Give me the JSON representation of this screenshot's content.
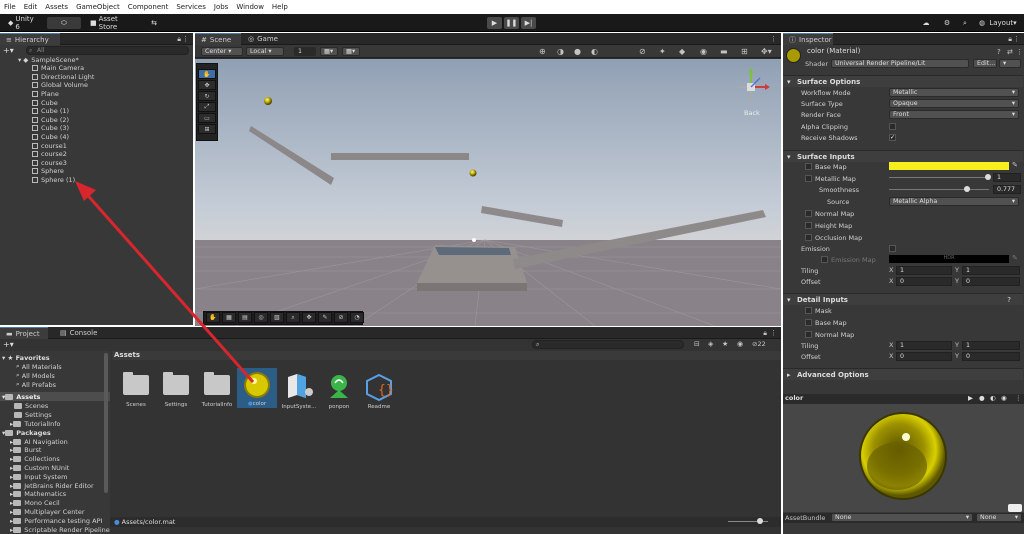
{
  "menubar": [
    "File",
    "Edit",
    "Assets",
    "GameObject",
    "Component",
    "Services",
    "Jobs",
    "Window",
    "Help"
  ],
  "toolbar": {
    "account": "Unity 6",
    "asset_store": "Asset Store",
    "layout": "Layout"
  },
  "hierarchy": {
    "tab": "Hierarchy",
    "search_placeholder": "All",
    "scene": "SampleScene*",
    "items": [
      "Main Camera",
      "Directional Light",
      "Global Volume",
      "Plane",
      "Cube",
      "Cube (1)",
      "Cube (2)",
      "Cube (3)",
      "Cube (4)",
      "course1",
      "course2",
      "course3",
      "Sphere",
      "Sphere (1)"
    ]
  },
  "scene_view": {
    "tabs": [
      "Scene",
      "Game"
    ],
    "pivot": "Center",
    "space": "Local",
    "snap": "1",
    "gizmo_label": "Back"
  },
  "project": {
    "tabs": [
      "Project",
      "Console"
    ],
    "favorites_label": "Favorites",
    "favorites": [
      "All Materials",
      "All Models",
      "All Prefabs"
    ],
    "assets_label": "Assets",
    "asset_folders": [
      "Scenes",
      "Settings",
      "TutorialInfo"
    ],
    "packages_label": "Packages",
    "packages": [
      "AI Navigation",
      "Burst",
      "Collections",
      "Custom NUnit",
      "Input System",
      "JetBrains Rider Editor",
      "Mathematics",
      "Mono Cecil",
      "Multiplayer Center",
      "Performance testing API",
      "Scriptable Render Pipeline"
    ],
    "breadcrumb": "Assets",
    "items": [
      "Scenes",
      "Settings",
      "TutorialInfo",
      "color",
      "InputSyste...",
      "ponpon",
      "Readme"
    ],
    "status_path": "Assets/color.mat",
    "count": "22"
  },
  "inspector": {
    "tab": "Inspector",
    "title": "color (Material)",
    "shader_label": "Shader",
    "shader_value": "Universal Render Pipeline/Lit",
    "edit_label": "Edit...",
    "surface_options": "Surface Options",
    "workflow_mode": {
      "label": "Workflow Mode",
      "value": "Metallic"
    },
    "surface_type": {
      "label": "Surface Type",
      "value": "Opaque"
    },
    "render_face": {
      "label": "Render Face",
      "value": "Front"
    },
    "alpha_clipping": "Alpha Clipping",
    "receive_shadows": "Receive Shadows",
    "surface_inputs": "Surface Inputs",
    "base_map": "Base Map",
    "base_color": "#f7ee1e",
    "metallic_map": "Metallic Map",
    "metallic_value": "1",
    "smoothness": "Smoothness",
    "smoothness_value": "0.777",
    "source": "Source",
    "source_value": "Metallic Alpha",
    "normal_map": "Normal Map",
    "height_map": "Height Map",
    "occlusion_map": "Occlusion Map",
    "emission": "Emission",
    "emission_map": "Emission Map",
    "hdr": "HDR",
    "tiling": "Tiling",
    "offset": "Offset",
    "tiling_x": "1",
    "tiling_y": "1",
    "offset_x": "0",
    "offset_y": "0",
    "detail_inputs": "Detail Inputs",
    "mask": "Mask",
    "detail_base_map": "Base Map",
    "detail_normal_map": "Normal Map",
    "d_tiling_x": "1",
    "d_tiling_y": "1",
    "d_offset_x": "0",
    "d_offset_y": "0",
    "advanced_options": "Advanced Options",
    "preview_label": "color",
    "asset_bundle": "AssetBundle",
    "bundle_none": "None",
    "bundle_none2": "None",
    "x": "X",
    "y": "Y"
  }
}
